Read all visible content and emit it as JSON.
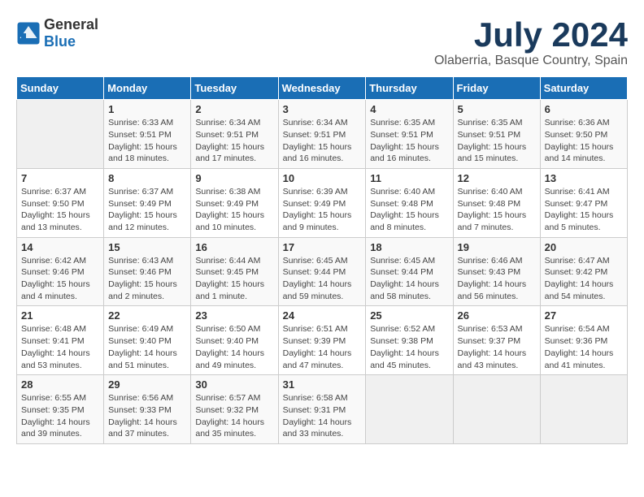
{
  "header": {
    "logo_general": "General",
    "logo_blue": "Blue",
    "month": "July 2024",
    "location": "Olaberria, Basque Country, Spain"
  },
  "weekdays": [
    "Sunday",
    "Monday",
    "Tuesday",
    "Wednesday",
    "Thursday",
    "Friday",
    "Saturday"
  ],
  "weeks": [
    [
      {
        "day": "",
        "info": ""
      },
      {
        "day": "1",
        "info": "Sunrise: 6:33 AM\nSunset: 9:51 PM\nDaylight: 15 hours and 18 minutes."
      },
      {
        "day": "2",
        "info": "Sunrise: 6:34 AM\nSunset: 9:51 PM\nDaylight: 15 hours and 17 minutes."
      },
      {
        "day": "3",
        "info": "Sunrise: 6:34 AM\nSunset: 9:51 PM\nDaylight: 15 hours and 16 minutes."
      },
      {
        "day": "4",
        "info": "Sunrise: 6:35 AM\nSunset: 9:51 PM\nDaylight: 15 hours and 16 minutes."
      },
      {
        "day": "5",
        "info": "Sunrise: 6:35 AM\nSunset: 9:51 PM\nDaylight: 15 hours and 15 minutes."
      },
      {
        "day": "6",
        "info": "Sunrise: 6:36 AM\nSunset: 9:50 PM\nDaylight: 15 hours and 14 minutes."
      }
    ],
    [
      {
        "day": "7",
        "info": "Sunrise: 6:37 AM\nSunset: 9:50 PM\nDaylight: 15 hours and 13 minutes."
      },
      {
        "day": "8",
        "info": "Sunrise: 6:37 AM\nSunset: 9:49 PM\nDaylight: 15 hours and 12 minutes."
      },
      {
        "day": "9",
        "info": "Sunrise: 6:38 AM\nSunset: 9:49 PM\nDaylight: 15 hours and 10 minutes."
      },
      {
        "day": "10",
        "info": "Sunrise: 6:39 AM\nSunset: 9:49 PM\nDaylight: 15 hours and 9 minutes."
      },
      {
        "day": "11",
        "info": "Sunrise: 6:40 AM\nSunset: 9:48 PM\nDaylight: 15 hours and 8 minutes."
      },
      {
        "day": "12",
        "info": "Sunrise: 6:40 AM\nSunset: 9:48 PM\nDaylight: 15 hours and 7 minutes."
      },
      {
        "day": "13",
        "info": "Sunrise: 6:41 AM\nSunset: 9:47 PM\nDaylight: 15 hours and 5 minutes."
      }
    ],
    [
      {
        "day": "14",
        "info": "Sunrise: 6:42 AM\nSunset: 9:46 PM\nDaylight: 15 hours and 4 minutes."
      },
      {
        "day": "15",
        "info": "Sunrise: 6:43 AM\nSunset: 9:46 PM\nDaylight: 15 hours and 2 minutes."
      },
      {
        "day": "16",
        "info": "Sunrise: 6:44 AM\nSunset: 9:45 PM\nDaylight: 15 hours and 1 minute."
      },
      {
        "day": "17",
        "info": "Sunrise: 6:45 AM\nSunset: 9:44 PM\nDaylight: 14 hours and 59 minutes."
      },
      {
        "day": "18",
        "info": "Sunrise: 6:45 AM\nSunset: 9:44 PM\nDaylight: 14 hours and 58 minutes."
      },
      {
        "day": "19",
        "info": "Sunrise: 6:46 AM\nSunset: 9:43 PM\nDaylight: 14 hours and 56 minutes."
      },
      {
        "day": "20",
        "info": "Sunrise: 6:47 AM\nSunset: 9:42 PM\nDaylight: 14 hours and 54 minutes."
      }
    ],
    [
      {
        "day": "21",
        "info": "Sunrise: 6:48 AM\nSunset: 9:41 PM\nDaylight: 14 hours and 53 minutes."
      },
      {
        "day": "22",
        "info": "Sunrise: 6:49 AM\nSunset: 9:40 PM\nDaylight: 14 hours and 51 minutes."
      },
      {
        "day": "23",
        "info": "Sunrise: 6:50 AM\nSunset: 9:40 PM\nDaylight: 14 hours and 49 minutes."
      },
      {
        "day": "24",
        "info": "Sunrise: 6:51 AM\nSunset: 9:39 PM\nDaylight: 14 hours and 47 minutes."
      },
      {
        "day": "25",
        "info": "Sunrise: 6:52 AM\nSunset: 9:38 PM\nDaylight: 14 hours and 45 minutes."
      },
      {
        "day": "26",
        "info": "Sunrise: 6:53 AM\nSunset: 9:37 PM\nDaylight: 14 hours and 43 minutes."
      },
      {
        "day": "27",
        "info": "Sunrise: 6:54 AM\nSunset: 9:36 PM\nDaylight: 14 hours and 41 minutes."
      }
    ],
    [
      {
        "day": "28",
        "info": "Sunrise: 6:55 AM\nSunset: 9:35 PM\nDaylight: 14 hours and 39 minutes."
      },
      {
        "day": "29",
        "info": "Sunrise: 6:56 AM\nSunset: 9:33 PM\nDaylight: 14 hours and 37 minutes."
      },
      {
        "day": "30",
        "info": "Sunrise: 6:57 AM\nSunset: 9:32 PM\nDaylight: 14 hours and 35 minutes."
      },
      {
        "day": "31",
        "info": "Sunrise: 6:58 AM\nSunset: 9:31 PM\nDaylight: 14 hours and 33 minutes."
      },
      {
        "day": "",
        "info": ""
      },
      {
        "day": "",
        "info": ""
      },
      {
        "day": "",
        "info": ""
      }
    ]
  ]
}
